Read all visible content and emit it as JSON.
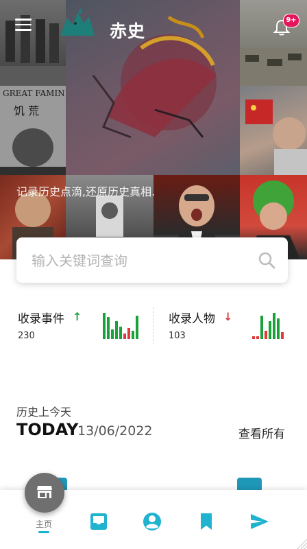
{
  "app": {
    "title": "赤史",
    "tagline": "记录历史点滴,还原历史真相.",
    "notification_badge": "9+",
    "accent_color": "#19b3cf",
    "badge_color": "#e3165b"
  },
  "hero": {
    "tile_captions": [
      "GREAT FAMIN",
      "饥 荒"
    ]
  },
  "search": {
    "placeholder": "输入关键词查询",
    "icon": "search-icon"
  },
  "stats": [
    {
      "label": "收录事件",
      "value": "230",
      "trend": "up",
      "trend_symbol": "↑",
      "trend_color": "#1aa23a"
    },
    {
      "label": "收录人物",
      "value": "103",
      "trend": "down",
      "trend_symbol": "↓",
      "trend_color": "#e03a3a"
    }
  ],
  "today": {
    "caption": "历史上今天",
    "label": "TODAY",
    "date": "13/06/2022",
    "view_all": "查看所有"
  },
  "nav": {
    "home_label": "主页",
    "icons": [
      "home-icon",
      "inbox-icon",
      "account-icon",
      "bookmark-icon",
      "send-icon"
    ]
  }
}
